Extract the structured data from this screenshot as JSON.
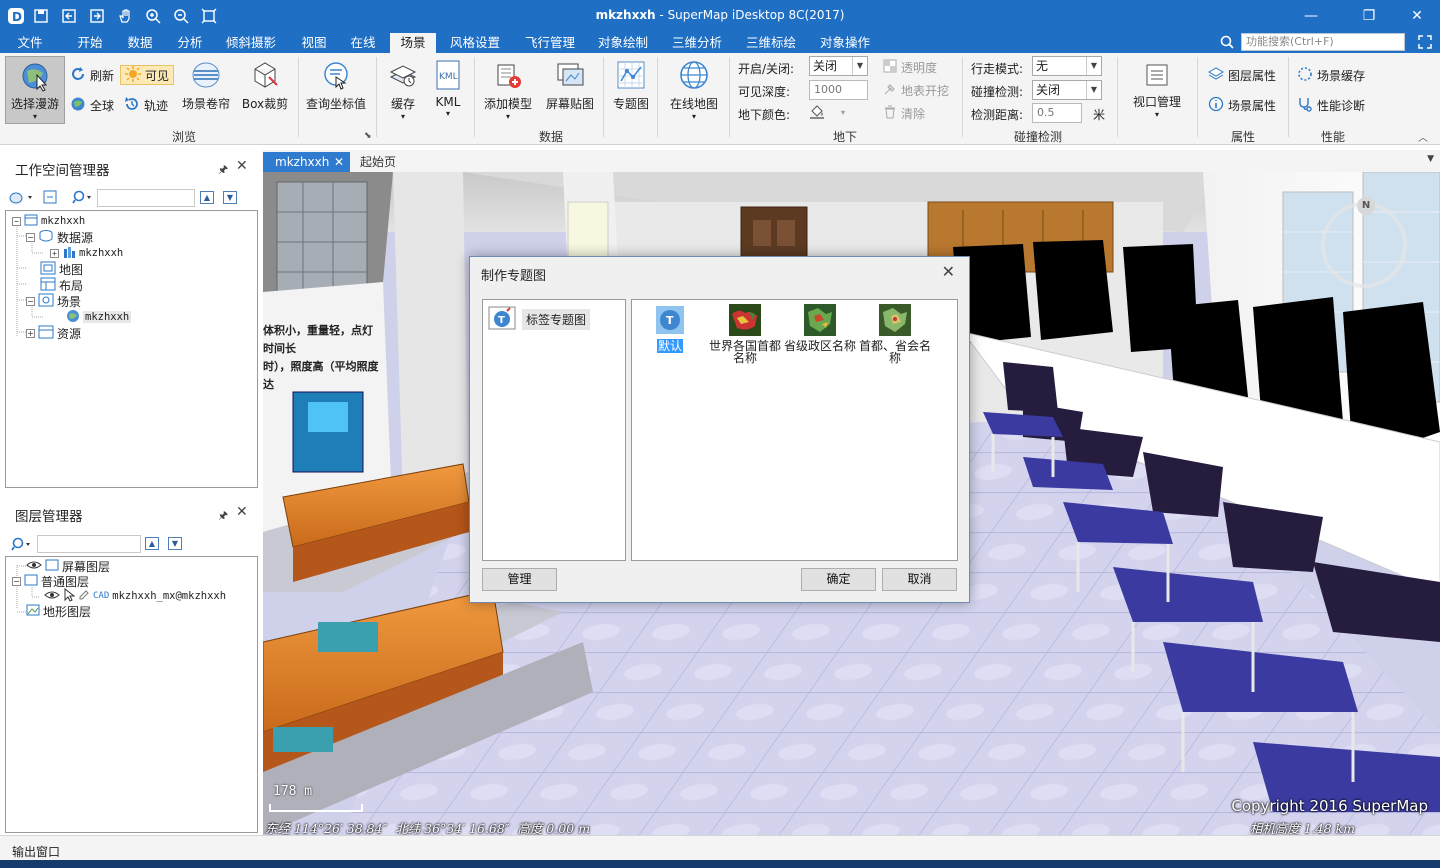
{
  "window": {
    "title_doc": "mkzhxxh",
    "title_app": " - SuperMap iDesktop 8C(2017)"
  },
  "menu": {
    "tabs": [
      "文件",
      "开始",
      "数据",
      "分析",
      "倾斜摄影",
      "视图",
      "在线",
      "场景",
      "风格设置",
      "飞行管理",
      "对象绘制",
      "三维分析",
      "三维标绘",
      "对象操作"
    ],
    "active": "场景",
    "search_placeholder": "功能搜索(Ctrl+F)"
  },
  "ribbon": {
    "browse": {
      "label": "浏览",
      "select_roam": "选择漫游",
      "refresh": "刷新",
      "visible": "可见",
      "globe": "全球",
      "track": "轨迹",
      "roll_curtain": "场景卷帘",
      "box_clip": "Box裁剪",
      "query_coord": "查询坐标值"
    },
    "data": {
      "label": "数据",
      "cache": "缓存",
      "kml": "KML",
      "add_model": "添加模型",
      "screen_sticker": "屏幕贴图",
      "thematic": "专题图",
      "online_map": "在线地图"
    },
    "underground": {
      "label": "地下",
      "onoff_label": "开启/关闭:",
      "onoff_value": "关闭",
      "depth_label": "可见深度:",
      "depth_value": "1000",
      "color_label": "地下颜色:",
      "transparency": "透明度",
      "surface_dig": "地表开挖",
      "clear": "清除"
    },
    "collision": {
      "label": "碰撞检测",
      "walk_label": "行走模式:",
      "walk_value": "无",
      "detect_label": "碰撞检测:",
      "detect_value": "关闭",
      "distance_label": "检测距离:",
      "distance_value": "0.5",
      "unit": "米"
    },
    "viewport": {
      "manage": "视口管理"
    },
    "properties": {
      "label": "属性",
      "layer_props": "图层属性",
      "scene_props": "场景属性"
    },
    "performance": {
      "label": "性能",
      "scene_cache": "场景缓存",
      "diagnose": "性能诊断"
    }
  },
  "workspace_panel": {
    "title": "工作空间管理器",
    "tree": {
      "root": "mkzhxxh",
      "datasources": "数据源",
      "datasource_item": "mkzhxxh",
      "maps": "地图",
      "layouts": "布局",
      "scenes": "场景",
      "scene_item": "mkzhxxh",
      "resources": "资源"
    }
  },
  "layer_panel": {
    "title": "图层管理器",
    "tree": {
      "screen_layers": "屏幕图层",
      "normal_layers": "普通图层",
      "cad_prefix": "CAD",
      "layer_item": "mkzhxxh_mx@mkzhxxh",
      "terrain_layers": "地形图层"
    }
  },
  "doc_tabs": {
    "active": "mkzhxxh",
    "start_page": "起始页"
  },
  "scene": {
    "compass": "N",
    "scale": "178 m",
    "coords": "东经 114°26′ 38.84″  北纬 36°34′ 16.68″  高度 0.00 m",
    "copyright": "Copyright 2016 SuperMap",
    "camera_height": "相机高度 1.48 km",
    "poster_text_1": "体积小，重量轻，点灯时间长",
    "poster_text_2": "时），照度高（平均照度达"
  },
  "dialog": {
    "title": "制作专题图",
    "category": "标签专题图",
    "templates": [
      "默认",
      "世界各国首都名称",
      "省级政区名称",
      "首都、省会名称"
    ],
    "manage": "管理",
    "ok": "确定",
    "cancel": "取消"
  },
  "status": {
    "output_window": "输出窗口"
  },
  "colors": {
    "titlebar": "#1f6fc5",
    "ribbon": "#f4f4f4",
    "selection": "#3399ff"
  }
}
